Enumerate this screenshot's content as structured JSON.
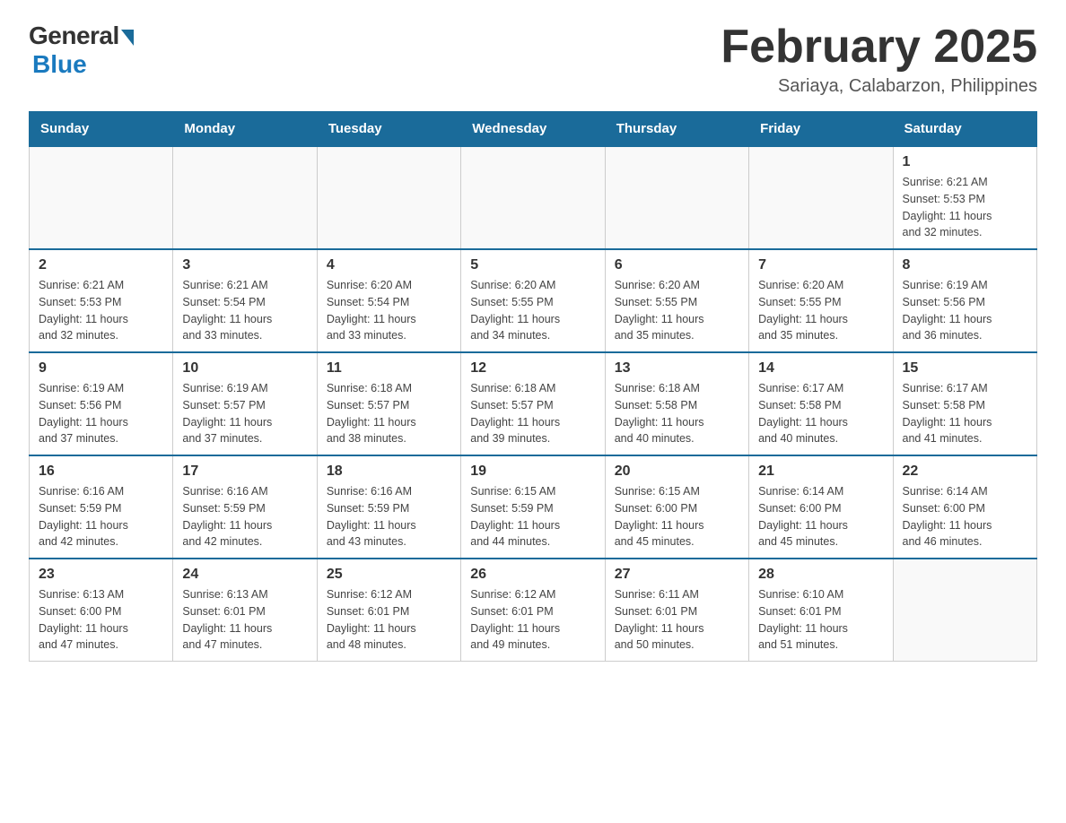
{
  "logo": {
    "general": "General",
    "blue": "Blue"
  },
  "title": "February 2025",
  "subtitle": "Sariaya, Calabarzon, Philippines",
  "days_of_week": [
    "Sunday",
    "Monday",
    "Tuesday",
    "Wednesday",
    "Thursday",
    "Friday",
    "Saturday"
  ],
  "weeks": [
    [
      {
        "day": "",
        "info": ""
      },
      {
        "day": "",
        "info": ""
      },
      {
        "day": "",
        "info": ""
      },
      {
        "day": "",
        "info": ""
      },
      {
        "day": "",
        "info": ""
      },
      {
        "day": "",
        "info": ""
      },
      {
        "day": "1",
        "info": "Sunrise: 6:21 AM\nSunset: 5:53 PM\nDaylight: 11 hours\nand 32 minutes."
      }
    ],
    [
      {
        "day": "2",
        "info": "Sunrise: 6:21 AM\nSunset: 5:53 PM\nDaylight: 11 hours\nand 32 minutes."
      },
      {
        "day": "3",
        "info": "Sunrise: 6:21 AM\nSunset: 5:54 PM\nDaylight: 11 hours\nand 33 minutes."
      },
      {
        "day": "4",
        "info": "Sunrise: 6:20 AM\nSunset: 5:54 PM\nDaylight: 11 hours\nand 33 minutes."
      },
      {
        "day": "5",
        "info": "Sunrise: 6:20 AM\nSunset: 5:55 PM\nDaylight: 11 hours\nand 34 minutes."
      },
      {
        "day": "6",
        "info": "Sunrise: 6:20 AM\nSunset: 5:55 PM\nDaylight: 11 hours\nand 35 minutes."
      },
      {
        "day": "7",
        "info": "Sunrise: 6:20 AM\nSunset: 5:55 PM\nDaylight: 11 hours\nand 35 minutes."
      },
      {
        "day": "8",
        "info": "Sunrise: 6:19 AM\nSunset: 5:56 PM\nDaylight: 11 hours\nand 36 minutes."
      }
    ],
    [
      {
        "day": "9",
        "info": "Sunrise: 6:19 AM\nSunset: 5:56 PM\nDaylight: 11 hours\nand 37 minutes."
      },
      {
        "day": "10",
        "info": "Sunrise: 6:19 AM\nSunset: 5:57 PM\nDaylight: 11 hours\nand 37 minutes."
      },
      {
        "day": "11",
        "info": "Sunrise: 6:18 AM\nSunset: 5:57 PM\nDaylight: 11 hours\nand 38 minutes."
      },
      {
        "day": "12",
        "info": "Sunrise: 6:18 AM\nSunset: 5:57 PM\nDaylight: 11 hours\nand 39 minutes."
      },
      {
        "day": "13",
        "info": "Sunrise: 6:18 AM\nSunset: 5:58 PM\nDaylight: 11 hours\nand 40 minutes."
      },
      {
        "day": "14",
        "info": "Sunrise: 6:17 AM\nSunset: 5:58 PM\nDaylight: 11 hours\nand 40 minutes."
      },
      {
        "day": "15",
        "info": "Sunrise: 6:17 AM\nSunset: 5:58 PM\nDaylight: 11 hours\nand 41 minutes."
      }
    ],
    [
      {
        "day": "16",
        "info": "Sunrise: 6:16 AM\nSunset: 5:59 PM\nDaylight: 11 hours\nand 42 minutes."
      },
      {
        "day": "17",
        "info": "Sunrise: 6:16 AM\nSunset: 5:59 PM\nDaylight: 11 hours\nand 42 minutes."
      },
      {
        "day": "18",
        "info": "Sunrise: 6:16 AM\nSunset: 5:59 PM\nDaylight: 11 hours\nand 43 minutes."
      },
      {
        "day": "19",
        "info": "Sunrise: 6:15 AM\nSunset: 5:59 PM\nDaylight: 11 hours\nand 44 minutes."
      },
      {
        "day": "20",
        "info": "Sunrise: 6:15 AM\nSunset: 6:00 PM\nDaylight: 11 hours\nand 45 minutes."
      },
      {
        "day": "21",
        "info": "Sunrise: 6:14 AM\nSunset: 6:00 PM\nDaylight: 11 hours\nand 45 minutes."
      },
      {
        "day": "22",
        "info": "Sunrise: 6:14 AM\nSunset: 6:00 PM\nDaylight: 11 hours\nand 46 minutes."
      }
    ],
    [
      {
        "day": "23",
        "info": "Sunrise: 6:13 AM\nSunset: 6:00 PM\nDaylight: 11 hours\nand 47 minutes."
      },
      {
        "day": "24",
        "info": "Sunrise: 6:13 AM\nSunset: 6:01 PM\nDaylight: 11 hours\nand 47 minutes."
      },
      {
        "day": "25",
        "info": "Sunrise: 6:12 AM\nSunset: 6:01 PM\nDaylight: 11 hours\nand 48 minutes."
      },
      {
        "day": "26",
        "info": "Sunrise: 6:12 AM\nSunset: 6:01 PM\nDaylight: 11 hours\nand 49 minutes."
      },
      {
        "day": "27",
        "info": "Sunrise: 6:11 AM\nSunset: 6:01 PM\nDaylight: 11 hours\nand 50 minutes."
      },
      {
        "day": "28",
        "info": "Sunrise: 6:10 AM\nSunset: 6:01 PM\nDaylight: 11 hours\nand 51 minutes."
      },
      {
        "day": "",
        "info": ""
      }
    ]
  ]
}
